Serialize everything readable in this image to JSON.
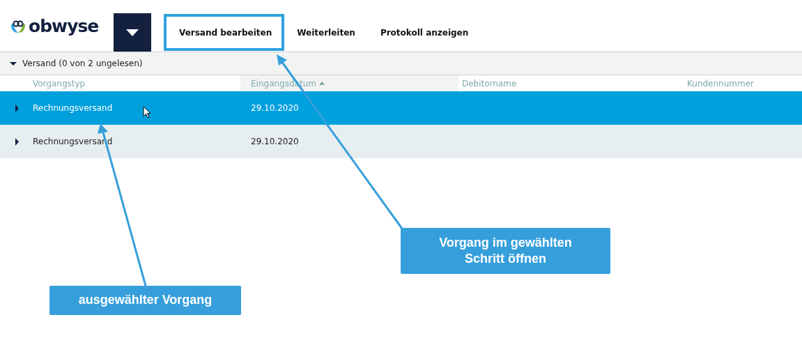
{
  "header": {
    "logo": "obwyse",
    "tabs": [
      {
        "label": "Versand bearbeiten",
        "highlighted": true
      },
      {
        "label": "Weiterleiten",
        "highlighted": false
      },
      {
        "label": "Protokoll anzeigen",
        "highlighted": false
      }
    ]
  },
  "group": {
    "label": "Versand (0 von 2 ungelesen)",
    "expanded": true
  },
  "table": {
    "columns": [
      {
        "label": "Vorgangstyp",
        "sorted": false
      },
      {
        "label": "Eingangsdatum",
        "sorted": true
      },
      {
        "label": "Debitorname",
        "sorted": false
      },
      {
        "label": "Kundennummer",
        "sorted": false
      }
    ],
    "rows": [
      {
        "selected": true,
        "expanded": false,
        "cells": [
          "Rechnungsversand",
          "29.10.2020"
        ]
      },
      {
        "selected": false,
        "expanded": false,
        "cells": [
          "Rechnungsversand",
          "29.10.2020"
        ]
      }
    ]
  },
  "callouts": [
    {
      "text": "Vorgang im gewählten Schritt öffnen"
    },
    {
      "text": "ausgewählter Vorgang"
    }
  ]
}
